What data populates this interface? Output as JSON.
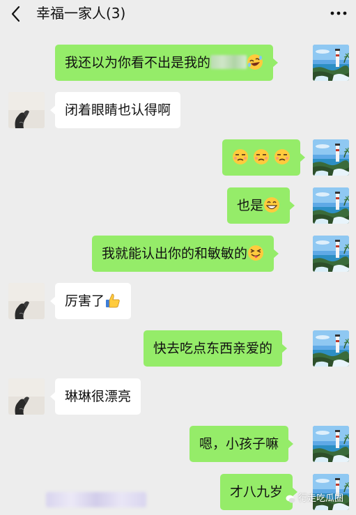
{
  "header": {
    "title": "幸福一家人(3)",
    "back_icon": "chevron-left-icon",
    "more_icon": "more-dots-icon"
  },
  "messages": [
    {
      "side": "me",
      "text": "我还以为你看不出是我的",
      "emoji": "rofl-face",
      "redacted": true
    },
    {
      "side": "other",
      "text": "闭着眼睛也认得啊"
    },
    {
      "side": "me",
      "text": "",
      "emoji": "unamused-face-x3"
    },
    {
      "side": "me",
      "text": "也是",
      "emoji": "grinning-face"
    },
    {
      "side": "me",
      "text": "我就能认出你的和敏敏的",
      "emoji": "tongue-wink-face"
    },
    {
      "side": "other",
      "text": "厉害了",
      "emoji": "thumbs-up"
    },
    {
      "side": "me",
      "text": "快去吃点东西亲爱的"
    },
    {
      "side": "other",
      "text": "琳琳很漂亮"
    },
    {
      "side": "me",
      "text": "嗯，小孩子嘛"
    },
    {
      "side": "me",
      "text": "才八九岁"
    }
  ],
  "watermark": {
    "text": "行走吃瓜圈"
  },
  "colors": {
    "background": "#ededed",
    "my_bubble": "#95ec69",
    "other_bubble": "#ffffff"
  }
}
